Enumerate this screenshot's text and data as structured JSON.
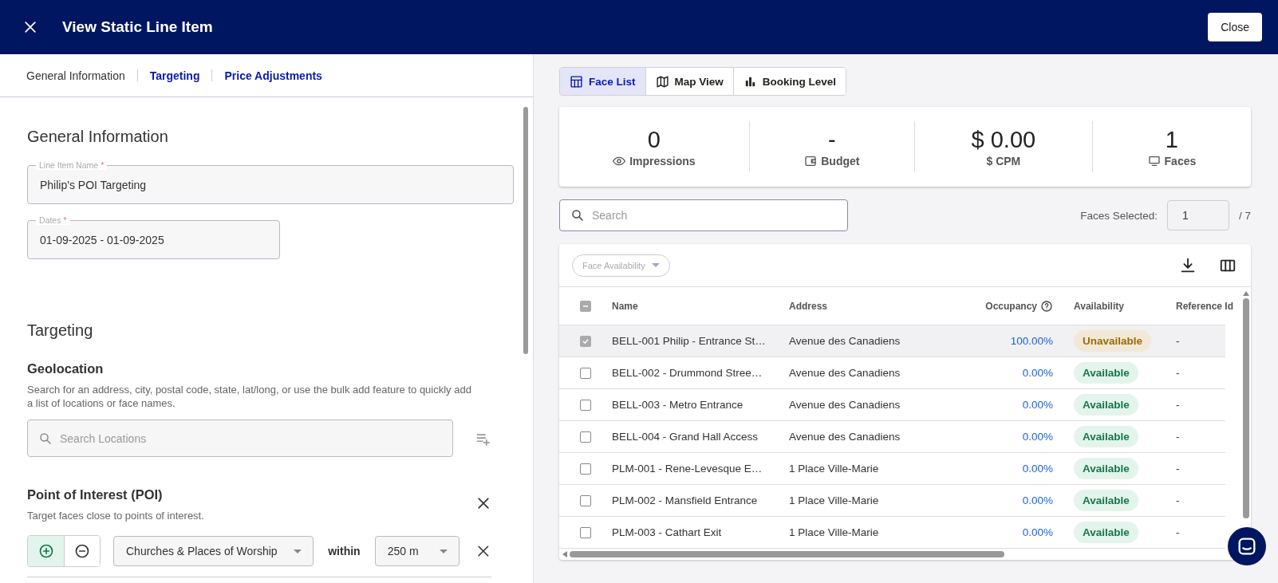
{
  "header": {
    "title": "View Static Line Item",
    "close_label": "Close"
  },
  "section_tabs": [
    {
      "label": "General Information",
      "selected": true
    },
    {
      "label": "Targeting",
      "selected": false
    },
    {
      "label": "Price Adjustments",
      "selected": false
    }
  ],
  "general": {
    "heading": "General Information",
    "fields": [
      {
        "label": "Line Item Name",
        "required": true,
        "required_mark": "*",
        "value": "Philip's POI Targeting",
        "wide": true
      },
      {
        "label": "Dates",
        "required": true,
        "required_mark": "*",
        "value": "01-09-2025 - 01-09-2025",
        "wide": false
      }
    ]
  },
  "targeting": {
    "heading": "Targeting",
    "geolocation": {
      "heading": "Geolocation",
      "description": "Search for an address, city, postal code, state, lat/long, or use the bulk add feature to quickly add a list of locations or face names.",
      "search_placeholder": "Search Locations"
    },
    "poi": {
      "heading": "Point of Interest (POI)",
      "description": "Target faces close to points of interest.",
      "mode": [
        {
          "kind": "include",
          "selected": true
        },
        {
          "kind": "exclude",
          "selected": false
        }
      ],
      "category": "Churches & Places of Worship",
      "within_label": "within",
      "distance": "250 m"
    }
  },
  "view_tabs": [
    {
      "label": "Face List",
      "kind": "table",
      "selected": true
    },
    {
      "label": "Map View",
      "kind": "map",
      "selected": false
    },
    {
      "label": "Booking Level",
      "kind": "chart",
      "selected": false
    }
  ],
  "stats": [
    {
      "value": "0",
      "label": "Impressions",
      "kind": "eye"
    },
    {
      "value": "-",
      "label": "Budget",
      "kind": "wallet"
    },
    {
      "value": "$ 0.00",
      "label": "$ CPM",
      "kind": "none"
    },
    {
      "value": "1",
      "label": "Faces",
      "kind": "screen"
    }
  ],
  "search": {
    "placeholder": "Search"
  },
  "faces_selected": {
    "label": "Faces Selected:",
    "value": "1",
    "total": "/ 7"
  },
  "table": {
    "filter_placeholder": "Face Availability",
    "select_all_indeterminate": true,
    "columns": [
      "Name",
      "Address",
      "Occupancy",
      "Availability",
      "Reference Id"
    ],
    "rows": [
      {
        "checked": true,
        "name": "BELL-001 Philip - Entrance St…",
        "address": "Avenue des Canadiens",
        "occupancy": "100.00%",
        "availability": {
          "label": "Unavailable",
          "kind": "unavailable"
        },
        "reference": "-"
      },
      {
        "checked": false,
        "name": "BELL-002 - Drummond Stree…",
        "address": "Avenue des Canadiens",
        "occupancy": "0.00%",
        "availability": {
          "label": "Available",
          "kind": "available"
        },
        "reference": "-"
      },
      {
        "checked": false,
        "name": "BELL-003 - Metro Entrance",
        "address": "Avenue des Canadiens",
        "occupancy": "0.00%",
        "availability": {
          "label": "Available",
          "kind": "available"
        },
        "reference": "-"
      },
      {
        "checked": false,
        "name": "BELL-004 - Grand Hall Access",
        "address": "Avenue des Canadiens",
        "occupancy": "0.00%",
        "availability": {
          "label": "Available",
          "kind": "available"
        },
        "reference": "-"
      },
      {
        "checked": false,
        "name": "PLM-001 - Rene-Levesque E…",
        "address": "1 Place Ville-Marie",
        "occupancy": "0.00%",
        "availability": {
          "label": "Available",
          "kind": "available"
        },
        "reference": "-"
      },
      {
        "checked": false,
        "name": "PLM-002 - Mansfield Entrance",
        "address": "1 Place Ville-Marie",
        "occupancy": "0.00%",
        "availability": {
          "label": "Available",
          "kind": "available"
        },
        "reference": "-"
      },
      {
        "checked": false,
        "name": "PLM-003 - Cathart Exit",
        "address": "1 Place Ville-Marie",
        "occupancy": "0.00%",
        "availability": {
          "label": "Available",
          "kind": "available"
        },
        "reference": "-"
      }
    ]
  }
}
